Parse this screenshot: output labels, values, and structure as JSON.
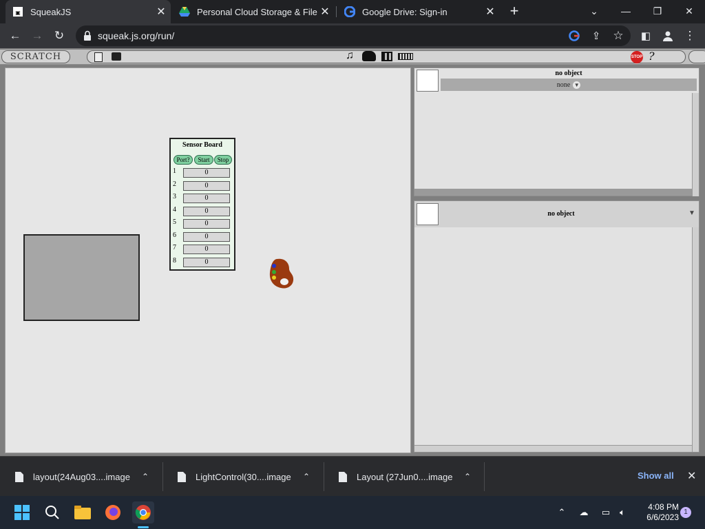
{
  "browser": {
    "tabs": [
      {
        "title": "SqueakJS",
        "icon": "squeakjs-favicon",
        "active": true
      },
      {
        "title": "Personal Cloud Storage & File Sh",
        "icon": "google-drive-favicon",
        "active": false
      },
      {
        "title": "Google Drive: Sign-in",
        "icon": "google-favicon",
        "active": false
      }
    ],
    "url": "squeak.js.org/run/"
  },
  "scratch": {
    "logo_text": "SCRATCH",
    "stop_label": "STOP",
    "help_label": "?",
    "sprite_panel": {
      "title": "no object",
      "dropdown_value": "none"
    },
    "sprite_panel_bottom": {
      "title": "no object"
    },
    "sensor_board": {
      "title": "Sensor Board",
      "buttons": [
        "Port?",
        "Start",
        "Stop"
      ],
      "rows": [
        {
          "label": "1",
          "value": "0"
        },
        {
          "label": "2",
          "value": "0"
        },
        {
          "label": "3",
          "value": "0"
        },
        {
          "label": "4",
          "value": "0"
        },
        {
          "label": "5",
          "value": "0"
        },
        {
          "label": "6",
          "value": "0"
        },
        {
          "label": "7",
          "value": "0"
        },
        {
          "label": "8",
          "value": "0"
        }
      ]
    }
  },
  "downloads": {
    "items": [
      {
        "name": "layout(24Aug03....image"
      },
      {
        "name": "LightControl(30....image"
      },
      {
        "name": "Layout (27Jun0....image"
      }
    ],
    "show_all": "Show all"
  },
  "taskbar": {
    "time": "4:08 PM",
    "date": "6/6/2023",
    "notification_count": "1"
  },
  "colors": {
    "stage_bg": "#e6e6e6",
    "sensor_button": "#7fcf9f",
    "palette_brown": "#9a3a10",
    "chrome_dark": "#202124",
    "link_blue": "#8ab4f8"
  }
}
